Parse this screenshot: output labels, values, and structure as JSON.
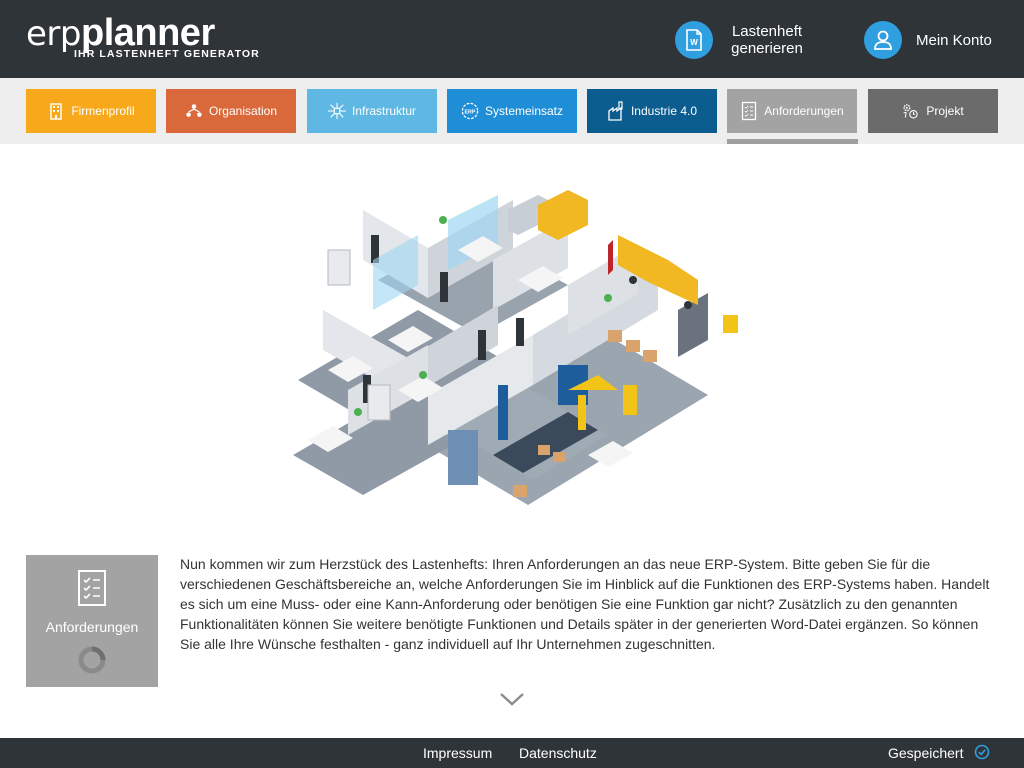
{
  "header": {
    "logo_light": "erp",
    "logo_bold": "planner",
    "logo_tagline": "IHR LASTENHEFT GENERATOR",
    "generate_label_1": "Lastenheft",
    "generate_label_2": "generieren",
    "account_label": "Mein Konto",
    "word_icon_letter": "W"
  },
  "tabs": [
    {
      "label": "Firmenprofil",
      "color": "#f7a81b",
      "icon": "building-icon"
    },
    {
      "label": "Organisation",
      "color": "#d9693a",
      "icon": "org-chart-icon"
    },
    {
      "label": "Infrastruktur",
      "color": "#5fb8e3",
      "icon": "network-icon"
    },
    {
      "label": "Systemeinsatz",
      "color": "#1f8ed6",
      "icon": "erp-icon"
    },
    {
      "label": "Industrie 4.0",
      "color": "#0b5c8f",
      "icon": "factory-icon"
    },
    {
      "label": "Anforderungen",
      "color": "#a3a3a3",
      "icon": "checklist-icon"
    },
    {
      "label": "Projekt",
      "color": "#6b6b6b",
      "icon": "project-gear-icon"
    }
  ],
  "infobox": {
    "label": "Anforderungen"
  },
  "description": "Nun kommen wir zum Herzstück des Lastenhefts: Ihren Anforderungen an das neue ERP-System. Bitte geben Sie für die verschiedenen Geschäftsbereiche an, welche Anforderungen Sie im Hinblick auf die Funktionen des ERP-Systems haben. Handelt es sich um eine Muss- oder eine Kann-Anforderung oder benötigen Sie eine Funktion gar nicht? Zusätzlich zu den genannten Funktionalitäten können Sie weitere benötigte Funktionen und Details später in der generierten Word-Datei ergänzen. So können Sie alle Ihre Wünsche festhalten - ganz individuell auf Ihr Unternehmen zugeschnitten.",
  "footer": {
    "impressum": "Impressum",
    "datenschutz": "Datenschutz",
    "saved": "Gespeichert"
  },
  "colors": {
    "dark": "#2f3438",
    "accent": "#2f9fe0"
  }
}
